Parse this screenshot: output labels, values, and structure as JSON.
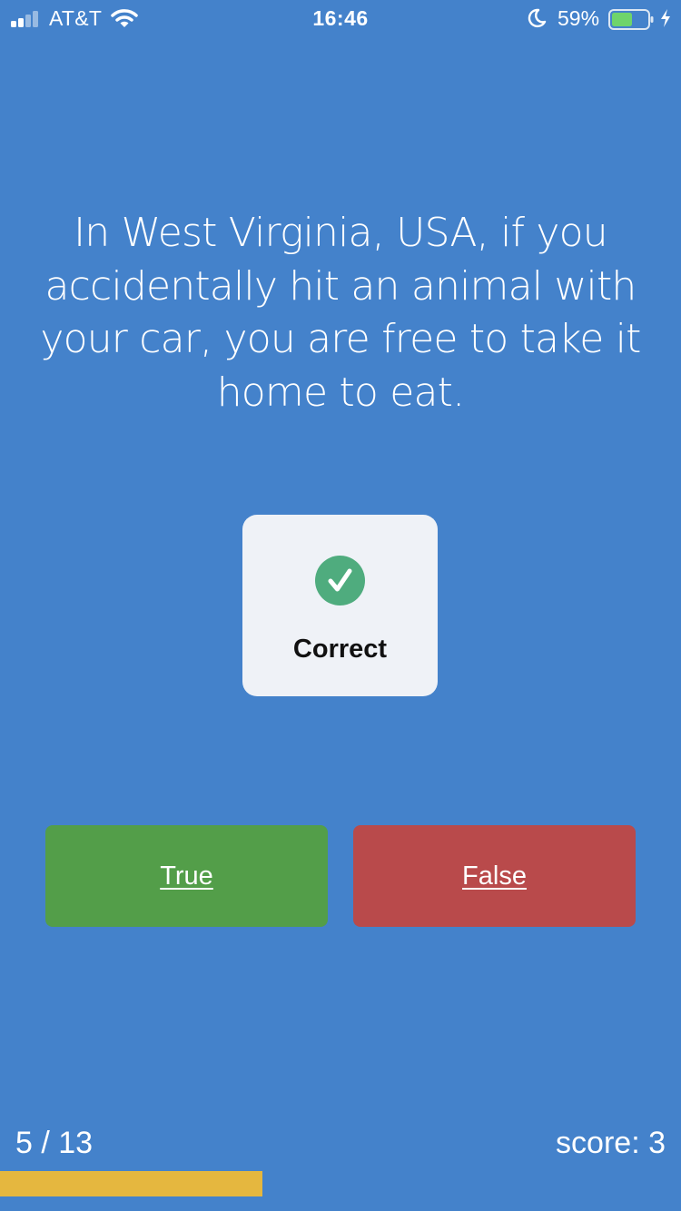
{
  "status_bar": {
    "carrier": "AT&T",
    "time": "16:46",
    "battery_percent": "59%",
    "battery_level": 0.59,
    "signal_bars_active": 2,
    "icons": [
      "signal-icon",
      "wifi-icon",
      "moon-icon",
      "battery-icon",
      "charging-bolt-icon"
    ]
  },
  "question": {
    "text": "In West Virginia, USA, if you accidentally hit an animal with your car, you are free to take it home to eat."
  },
  "feedback": {
    "label": "Correct",
    "icon": "check-circle-icon"
  },
  "answers": {
    "true_label": "True",
    "false_label": "False"
  },
  "footer": {
    "progress_label": "5 / 13",
    "score_label": "score: 3",
    "progress_fraction": 0.385
  },
  "colors": {
    "background": "#4482cb",
    "true_button": "#539e49",
    "false_button": "#b94a4b",
    "card": "#eff2f7",
    "check": "#4fac7e",
    "progress_bar": "#e5b73f"
  }
}
